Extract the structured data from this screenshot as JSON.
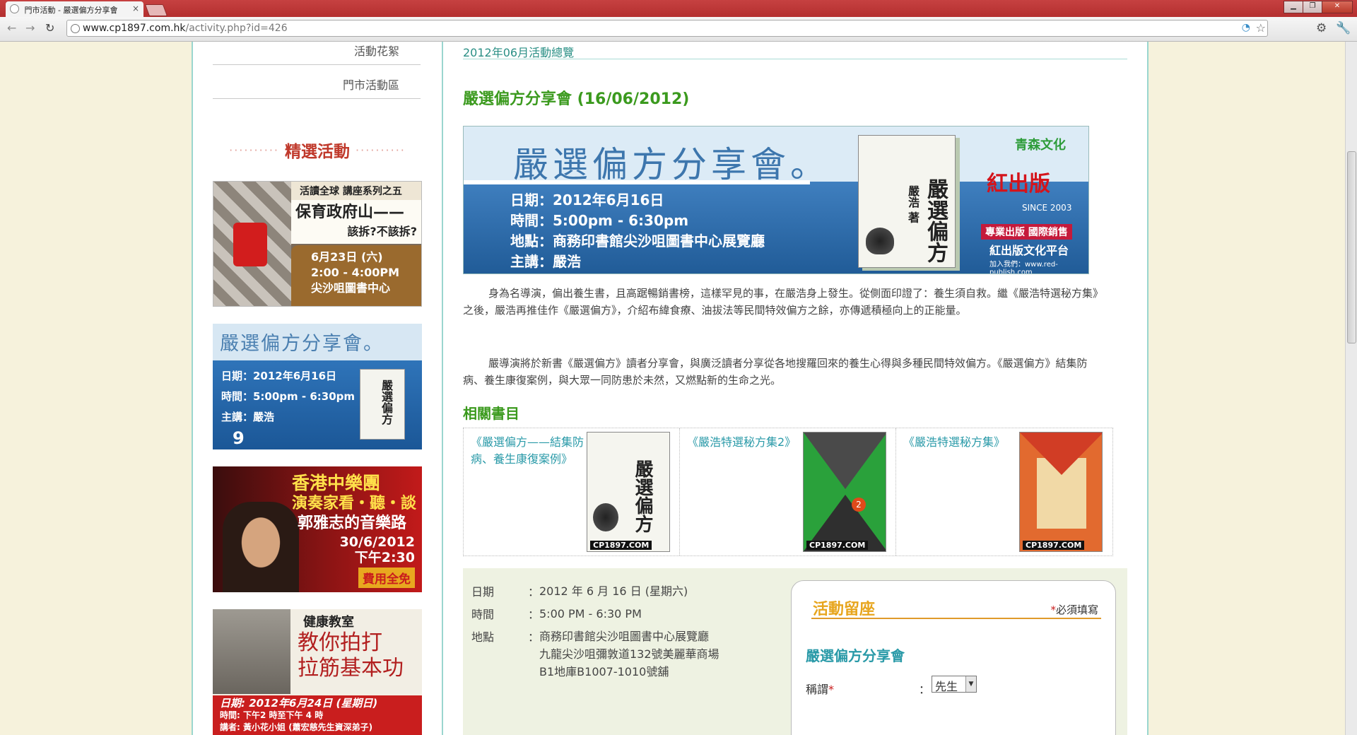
{
  "browser": {
    "tab_title": "門市活動 - 嚴選偏方分享會",
    "tab_close": "×",
    "url_host": "www.cp1897.com.hk",
    "url_path": "/activity.php?id=426",
    "window_buttons": [
      "▁",
      "❐",
      "✕"
    ],
    "back_glyph": "←",
    "forward_glyph": "→",
    "reload_glyph": "↻",
    "star_glyph": "☆",
    "wrench_glyph": "🔧"
  },
  "sidebar": {
    "links": [
      "活動花絮",
      "門市活動區"
    ],
    "featured_title": "精選活動",
    "dots": "··········",
    "banner1": {
      "head": "活讀全球 講座系列之五",
      "title": "保育政府山——",
      "sub": "該拆?不該拆?",
      "date": "6月23日 (六)",
      "time": "2:00 - 4:00PM",
      "venue": "尖沙咀圖書中心"
    },
    "banner2": {
      "title": "嚴選偏方分享會。",
      "line1": "日期：2012年6月16日",
      "line2": "時間：5:00pm - 6:30pm",
      "line3": "主講：嚴浩",
      "book": "嚴選偏方",
      "nine": "9"
    },
    "banner3": {
      "l1": "香港中樂團",
      "l2": "演奏家看・聽・談",
      "l3": "郭雅志的音樂路",
      "date": "30/6/2012",
      "time": "下午2:30",
      "free": "費用全免"
    },
    "banner4": {
      "head": "健康教室",
      "big1": "教你拍打",
      "big2": "拉筋基本功",
      "date": "日期: 2012年6月24日 (星期日)",
      "time": "時間: 下午2 時至下午 4 時",
      "speaker": "講者: 黃小花小姐 (蕭宏慈先生資深弟子)"
    }
  },
  "main": {
    "breadcrumb": "2012年06月活動總覽",
    "event_title": "嚴選偏方分享會 (16/06/2012)",
    "hero": {
      "title": "嚴選偏方分享會。",
      "line1": "日期：2012年6月16日",
      "line2": "時間：5:00pm - 6:30pm",
      "line3": "地點：商務印書館尖沙咀圖書中心展覽廳",
      "line4": "主講：嚴浩",
      "book_title": "嚴選偏方",
      "book_author": "嚴浩 著",
      "logo": "青森文化",
      "red": "紅出版",
      "since": "SINCE 2003",
      "pub": "專業出版 國際銷售",
      "pub2": "紅出版文化平台",
      "url": "加入我們：www.red-publish.com"
    },
    "paragraph1": "身為名導演，偏出養生書，且高踞暢銷書榜，這樣罕見的事，在嚴浩身上發生。從側面印證了：養生須自救。繼《嚴浩特選秘方集》之後，嚴浩再推佳作《嚴選偏方》，介紹布緯食療、油拔法等民間特效偏方之餘，亦傳遞積極向上的正能量。",
    "paragraph2": "嚴導演將於新書《嚴選偏方》讀者分享會，與廣泛讀者分享從各地搜羅回來的養生心得與多種民間特效偏方。《嚴選偏方》結集防病、養生康復案例，與大眾一同防患於未然，又燃點新的生命之光。",
    "related_title": "相關書目",
    "related": [
      {
        "title": "《嚴選偏方——結集防病、養生康復案例》",
        "badge": "CP1897.COM"
      },
      {
        "title": "《嚴浩特選秘方集2》",
        "badge": "CP1897.COM",
        "num": "2"
      },
      {
        "title": "《嚴浩特選秘方集》",
        "badge": "CP1897.COM"
      }
    ],
    "details": {
      "date_label": "日期",
      "date_value": "2012 年 6 月 16 日 (星期六)",
      "time_label": "時間",
      "time_value": "5:00 PM - 6:30 PM",
      "venue_label": "地點",
      "venue_line1": "商務印書館尖沙咀圖書中心展覽廳",
      "venue_line2": "九龍尖沙咀彌敦道132號美麗華商場",
      "venue_line3": "B1地庫B1007-1010號舖",
      "colon": "："
    },
    "form": {
      "title": "活動留座",
      "required_star": "*",
      "required_text": "必須填寫",
      "event_name": "嚴選偏方分享會",
      "salutation_label": "稱謂",
      "salutation_value": "先生",
      "colon": "："
    }
  }
}
